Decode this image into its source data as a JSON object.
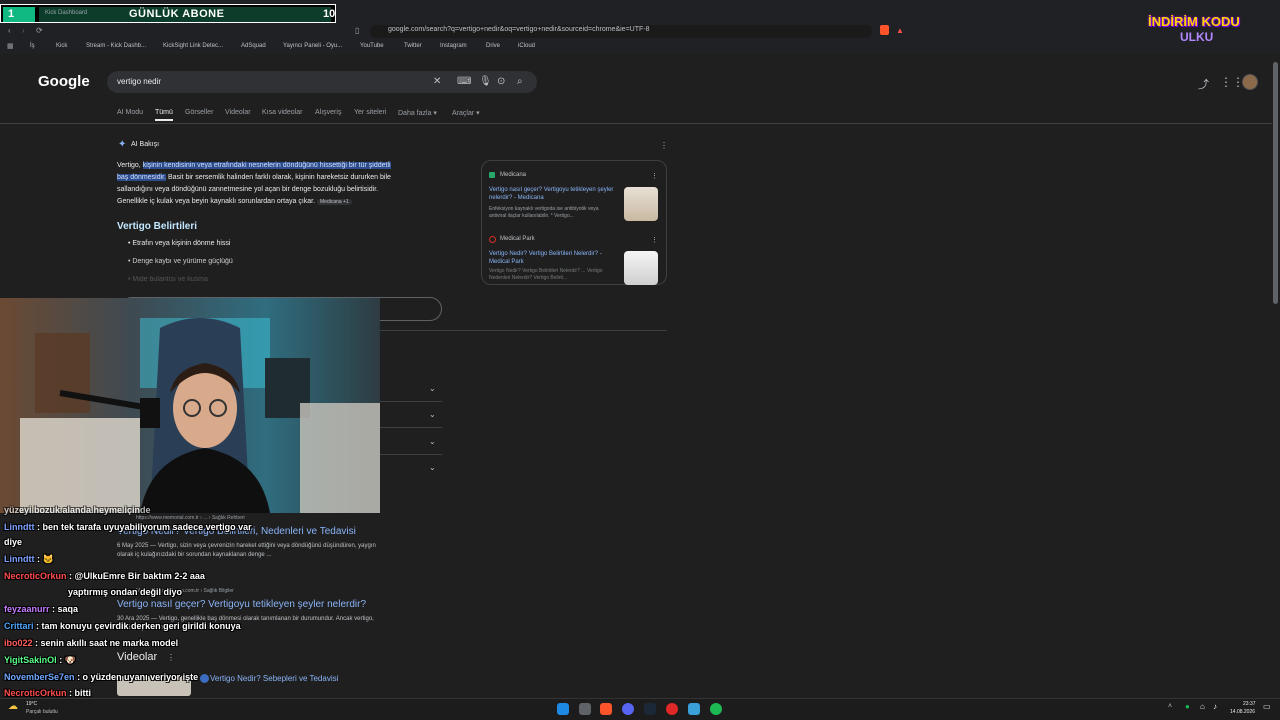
{
  "overlay": {
    "counter_left": "1",
    "label": "GÜNLÜK ABONE",
    "counter_right": "10",
    "tab_text": "Kick Dashboard",
    "promo_line1": "İNDİRİM KODU",
    "promo_line2": "ULKU"
  },
  "browser": {
    "url": "google.com/search?q=vertigo+nedir&oq=vertigo+nedir&sourceid=chrome&ie=UTF-8",
    "bookmarks": [
      "İş",
      "Kick",
      "Stream - Kick Dashb...",
      "KickSight Link Detec...",
      "AdSquad",
      "Yayıncı Paneli - Oyu...",
      "YouTube",
      "Twitter",
      "Instagram",
      "Drive",
      "iCloud"
    ]
  },
  "google": {
    "logo": "Google",
    "query": "vertigo nedir",
    "tabs": [
      "AI Modu",
      "Tümü",
      "Görseller",
      "Videolar",
      "Kısa videolar",
      "Alışveriş",
      "Yer siteleri",
      "Daha fazla ▾",
      "Araçlar ▾"
    ]
  },
  "ai_overview": {
    "label": "AI Bakışı",
    "line1_a": "Vertigo, ",
    "line1_hl": "kişinin kendisinin veya etrafındaki nesnelerin döndüğünü hissettiği bir tür şiddetli",
    "line2_hl": "baş dönmesidir.",
    "line2_b": " Basit bir sersemlik halinden farklı olarak, kişinin hareketsiz dururken bile",
    "line3": "sallandığını veya döndüğünü zannetmesine yol açan bir denge bozukluğu belirtisidir.",
    "line4": "Genellikle iç kulak veya beyin kaynaklı sorunlardan ortaya çıkar.",
    "line4_chip": "Medicana +1",
    "heading": "Vertigo Belirtileri",
    "bullets": [
      "Etrafın veya kişinin dönme hissi",
      "Denge kaybı ve yürüme güçlüğü",
      "Mide bulantısı ve kusma"
    ],
    "sources": [
      {
        "name": "Medicana",
        "title": "Vertigo nasıl geçer? Vertigoyu tetikleyen şeyler nelerdir? - Medicana",
        "desc": "Enfeksiyon kaynaklı vertigoda ise antibiyotik veya antiviral ilaçlar kullanılabilir. * Vertigo..."
      },
      {
        "name": "Medical Park",
        "title": "Vertigo Nedir? Vertigo Belirtileri Nelerdir? - Medical Park",
        "desc": "Vertigo Nedir? Vertigo Belirtileri Nelerdir? ... Vertigo Nedenleri Nelerdir? Vertigo Belirti..."
      }
    ]
  },
  "results": [
    {
      "site": "https://www.memorial.com.tr › ... › Sağlık Rehberi",
      "title": "Vertigo Nedir? Vertigo Belirtileri, Nedenleri ve Tedavisi",
      "desc_1": "6 May 2025 — Vertigo, sizin veya çevrenizin hareket ettiğini veya döndüğünü düşündüren, yaygın",
      "desc_2": "olarak iç kulağınızdaki bir sorundan kaynaklanan denge ..."
    },
    {
      "site": "Medicana · medicana.com.tr › Sağlık Bilgiler",
      "title": "Vertigo nasıl geçer? Vertigoyu tetikleyen şeyler nelerdir?",
      "desc_1": "30 Ara 2025 — Vertigo, genellikle baş dönmesi olarak tanımlanan bir durumundur. Ancak vertigo,",
      "desc_2": "üzerinde yer alan ..."
    }
  ],
  "videos": {
    "heading": "Videolar",
    "title": "Vertigo Nedir? Sebepleri ve Tedavisi"
  },
  "chat": [
    {
      "user": "",
      "color": "#ffffff",
      "msg": "yüzeyi bozuk alanda heyme içinde"
    },
    {
      "user": "Linndtt",
      "color": "#7aa2ff",
      "msg": ": ben tek tarafa uyuyabiliyorum sadece vertigo var"
    },
    {
      "user": "",
      "color": "#ffffff",
      "msg": "diye"
    },
    {
      "user": "Linndtt",
      "color": "#7aa2ff",
      "msg": ": 🐱"
    },
    {
      "user": "NecroticOrkun",
      "color": "#ff4d4d",
      "msg": ": @UlkuEmre Bir baktım 2-2 aaa"
    },
    {
      "user": "",
      "color": "#ffffff",
      "msg": "yaptırmış ondan değil diyo"
    },
    {
      "user": "feyzaanurr",
      "color": "#c77dff",
      "msg": ": yaptırmış ondan değil diyo"
    },
    {
      "user": "feyzaanurr",
      "color": "#c77dff",
      "msg": ": saqa"
    },
    {
      "user": "Crittari",
      "color": "#4da6ff",
      "msg": ": tam konuyu çevirdik derken geri girildi konuya"
    },
    {
      "user": "ibo022",
      "color": "#ff5c5c",
      "msg": ": senin akıllı saat ne marka model"
    },
    {
      "user": "YigitSakinOl",
      "color": "#5cff8a",
      "msg": ": 🐶"
    },
    {
      "user": "NovemberSe7en",
      "color": "#6fa8ff",
      "msg": ": o yüzden uyanı veriyor işte"
    },
    {
      "user": "NecroticOrkun",
      "color": "#ff4d4d",
      "msg": ": bitti"
    }
  ],
  "taskbar": {
    "temp": "19°C",
    "weather": "Parçalı bulutlu",
    "time": "23:37",
    "date": "14.08.2026"
  }
}
